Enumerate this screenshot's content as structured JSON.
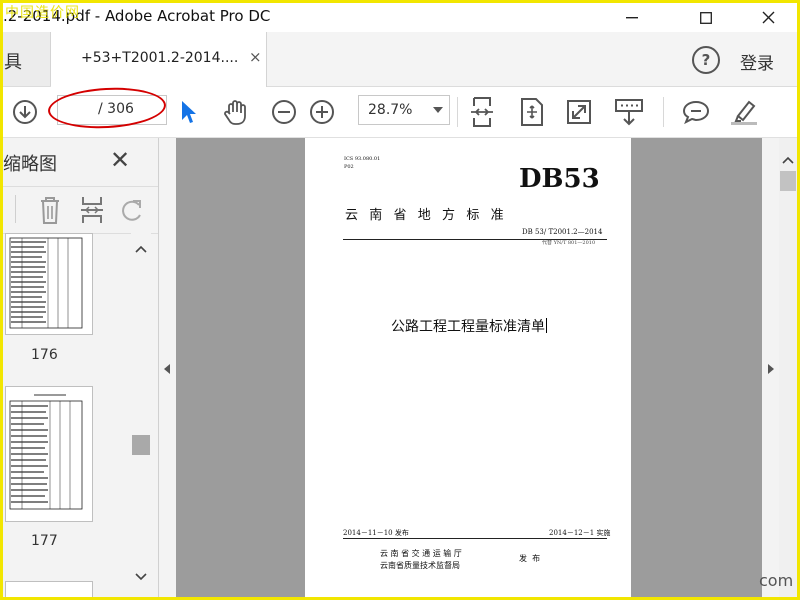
{
  "window": {
    "title": ".2-2014.pdf - Adobe Acrobat Pro DC",
    "watermark": "中国造价网",
    "buttons": {
      "minimize": "–",
      "maximize": "☐",
      "close": "✕"
    }
  },
  "tabbar": {
    "left_tab_label": "具",
    "active_tab": {
      "label": "+53+T2001.2-2014....",
      "close": "×"
    },
    "help_label": "?",
    "login_label": "登录"
  },
  "toolbar": {
    "current_page": "",
    "page_total": "/ 306",
    "zoom_value": "28.7%",
    "icons": [
      "page-down-icon",
      "select-cursor-icon",
      "hand-tool-icon",
      "zoom-out-icon",
      "zoom-in-icon",
      "fit-width-icon",
      "rotate-view-icon",
      "full-screen-icon",
      "read-mode-icon",
      "comment-icon",
      "highlight-pen-icon"
    ]
  },
  "sidebar": {
    "title": "缩略图",
    "close": "✕",
    "thumbnails": [
      {
        "label": "176"
      },
      {
        "label": "177"
      }
    ]
  },
  "document": {
    "ics_line": "ICS 93.080.01",
    "class_code": "P02",
    "standard_code": "DB53",
    "standard_category": "云  南  省  地  方  标  准",
    "standard_number": "DB 53/ T2001.2—2014",
    "replaces": "代替 YN/T 801—2010",
    "title": "公路工程工程量标准清单",
    "publish_date": "2014－11－10 发布",
    "implement_date": "2014－12－1 实施",
    "issuer_line1": "云 南 省 交 通 运 输 厅",
    "issuer_line2": "云南省质量技术监督局",
    "issue_word": "发  布"
  },
  "corner_mark": "com",
  "colors": {
    "frame": "#f2e600",
    "annotation": "#d40000",
    "select_cursor": "#1473e6",
    "doc_background": "#9c9c9c"
  }
}
